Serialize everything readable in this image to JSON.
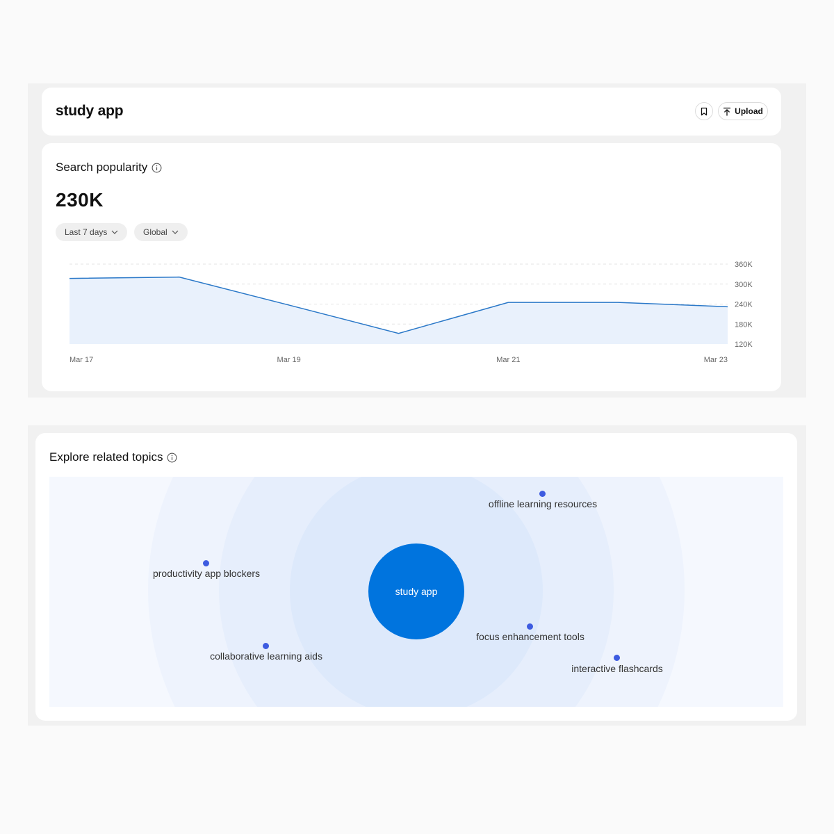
{
  "header": {
    "title": "study app",
    "bookmark_icon": "bookmark-icon",
    "upload_label": "Upload",
    "upload_icon": "upload-icon"
  },
  "search_popularity": {
    "title": "Search popularity",
    "value": "230K",
    "filters": {
      "time_range": "Last 7 days",
      "region": "Global"
    }
  },
  "chart_data": {
    "type": "area",
    "x": [
      "Mar 17",
      "Mar 18",
      "Mar 19",
      "Mar 20",
      "Mar 21",
      "Mar 22",
      "Mar 23"
    ],
    "x_tick_labels": [
      "Mar 17",
      "Mar 19",
      "Mar 21",
      "Mar 23"
    ],
    "values": [
      317000,
      321000,
      237000,
      152000,
      245000,
      245000,
      232000
    ],
    "y_tick_labels": [
      "360K",
      "300K",
      "240K",
      "180K",
      "120K"
    ],
    "y_ticks": [
      360000,
      300000,
      240000,
      180000,
      120000
    ],
    "ylim": [
      120000,
      360000
    ],
    "y_axis_side": "right",
    "grid": "horizontal dashed",
    "line_color": "#2a78c8",
    "fill_color": "#e9f1fc"
  },
  "related_topics": {
    "title": "Explore related topics",
    "center_topic": "study app",
    "topics": [
      "offline learning resources",
      "productivity app blockers",
      "focus enhancement tools",
      "collaborative learning aids",
      "interactive flashcards"
    ],
    "colors": {
      "center": "#0074de",
      "dot": "#3d5be0"
    }
  }
}
